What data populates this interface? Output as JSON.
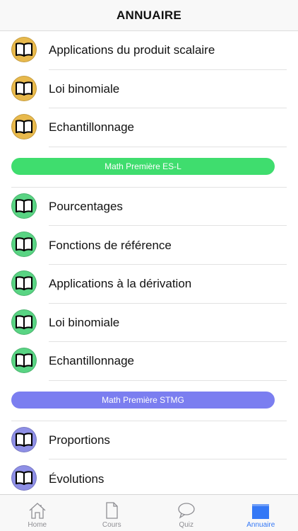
{
  "navbar": {
    "title": "ANNUAIRE"
  },
  "colors": {
    "gold": "#e8b94c",
    "green": "#59d483",
    "purple": "#8e8fe6",
    "pill_green": "#3fdd6e",
    "pill_purple": "#7b7ef0",
    "accent": "#3478f6"
  },
  "sections": [
    {
      "header": null,
      "color": "gold",
      "items": [
        {
          "label": "Applications du produit scalaire"
        },
        {
          "label": "Loi binomiale"
        },
        {
          "label": "Echantillonnage"
        }
      ]
    },
    {
      "header": "Math Première ES-L",
      "color": "green",
      "pill": "pill_green",
      "items": [
        {
          "label": "Pourcentages"
        },
        {
          "label": "Fonctions de référence"
        },
        {
          "label": "Applications à la dérivation"
        },
        {
          "label": "Loi binomiale"
        },
        {
          "label": "Echantillonnage"
        }
      ]
    },
    {
      "header": "Math Première STMG",
      "color": "purple",
      "pill": "pill_purple",
      "items": [
        {
          "label": "Proportions"
        },
        {
          "label": "Évolutions"
        }
      ]
    }
  ],
  "tabbar": {
    "tabs": [
      {
        "label": "Home",
        "icon": "home-icon",
        "active": false
      },
      {
        "label": "Cours",
        "icon": "document-icon",
        "active": false
      },
      {
        "label": "Quiz",
        "icon": "chat-bubble-icon",
        "active": false
      },
      {
        "label": "Annuaire",
        "icon": "folder-icon",
        "active": true
      }
    ]
  }
}
